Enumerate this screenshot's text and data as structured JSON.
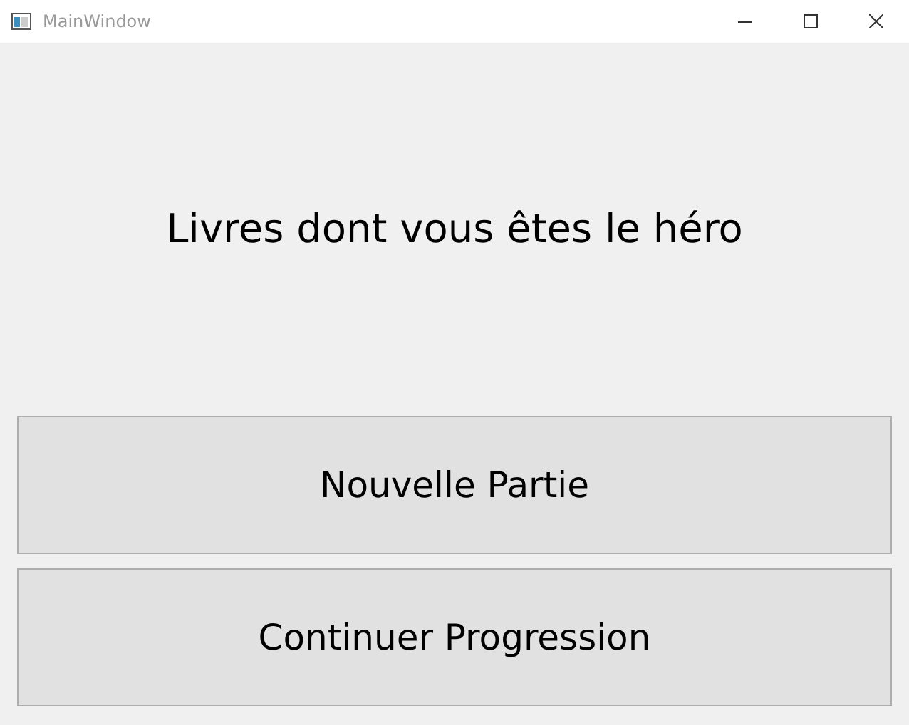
{
  "window": {
    "title": "MainWindow"
  },
  "heading": "Livres dont vous êtes le héro",
  "buttons": [
    {
      "label": "Nouvelle Partie"
    },
    {
      "label": "Continuer Progression"
    }
  ]
}
